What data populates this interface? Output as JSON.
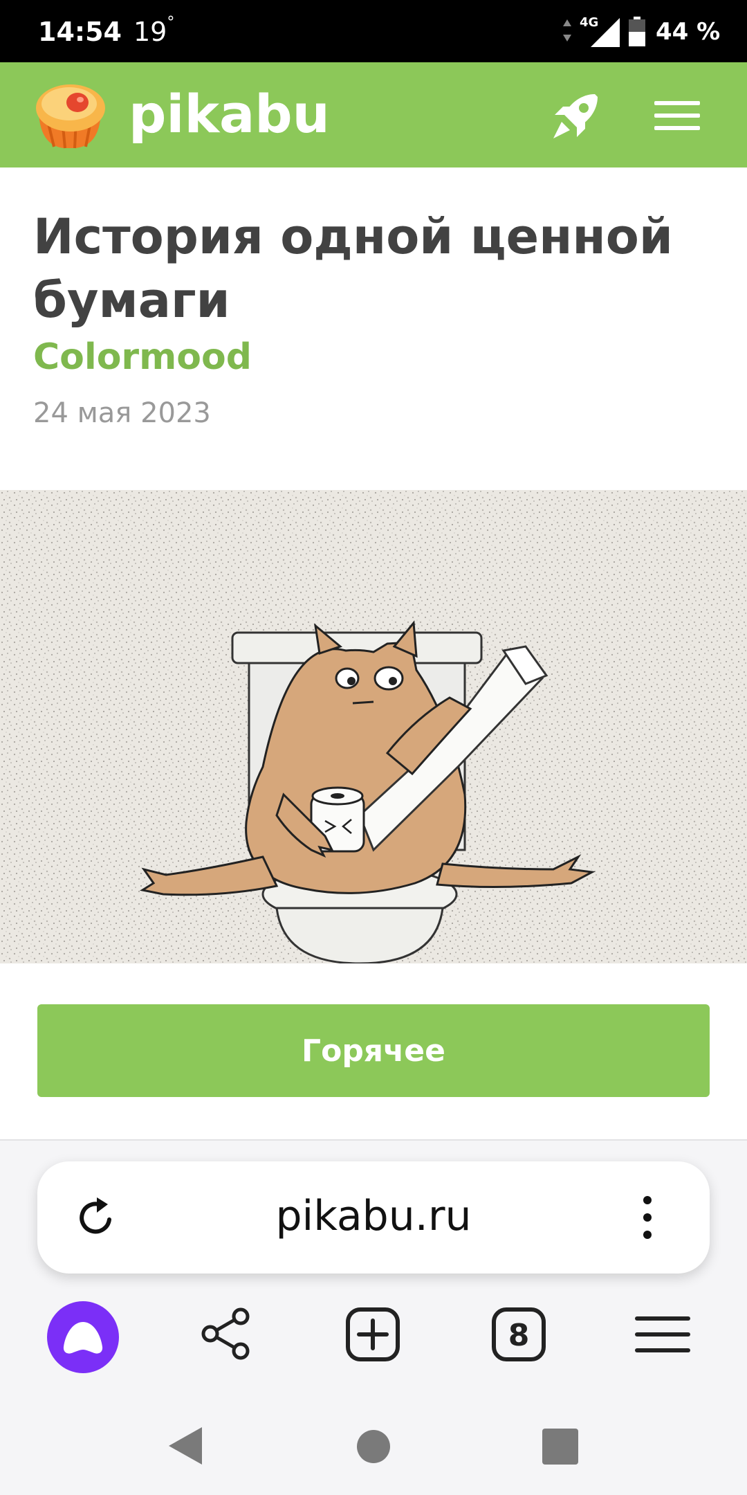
{
  "status_bar": {
    "time": "14:54",
    "temperature": "19",
    "degree_symbol": "°",
    "network": "4G",
    "battery": "44 %"
  },
  "header": {
    "brand": "pikabu",
    "logo_icon": "cupcake-logo-icon",
    "rocket_icon": "rocket-icon",
    "menu_icon": "hamburger-menu-icon"
  },
  "article": {
    "title": "История одной ценной бумаги",
    "author": "Colormood",
    "date": "24 мая 2023",
    "image_alt": "cat-on-toilet-illustration"
  },
  "hot_button": {
    "label": "Горячее"
  },
  "browser": {
    "url": "pikabu.ru",
    "tabs_count": "8",
    "reload_icon": "reload-icon",
    "more_icon": "more-vertical-icon",
    "alice_icon": "alice-assistant-icon",
    "share_icon": "share-icon",
    "new_tab_icon": "new-tab-icon",
    "tabs_icon": "tabs-icon",
    "browser_menu_icon": "browser-menu-icon"
  },
  "system_nav": {
    "back_icon": "back-icon",
    "home_icon": "home-icon",
    "recents_icon": "recents-icon"
  },
  "colors": {
    "brand_green": "#8cc859",
    "author_green": "#7fb84e",
    "alice_purple": "#7b2ff7"
  }
}
